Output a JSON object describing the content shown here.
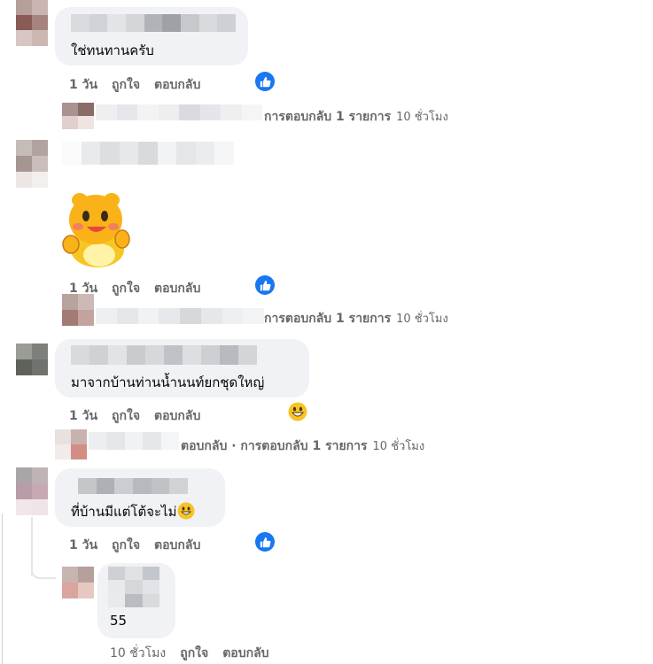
{
  "comments": [
    {
      "text": "ใช่ทนทานครับ",
      "actions": {
        "time": "1 วัน",
        "like": "ถูกใจ",
        "reply": "ตอบกลับ"
      },
      "replies_summary": {
        "text": "การตอบกลับ 1 รายการ",
        "time": "10 ชั่วโมง"
      }
    },
    {
      "text": "",
      "actions": {
        "time": "1 วัน",
        "like": "ถูกใจ",
        "reply": "ตอบกลับ"
      },
      "replies_summary": {
        "text": "การตอบกลับ 1 รายการ",
        "time": "10 ชั่วโมง"
      }
    },
    {
      "text": "มาจากบ้านท่านน้ำนนท์ยกชุดใหญ่",
      "actions": {
        "time": "1 วัน",
        "like": "ถูกใจ",
        "reply": "ตอบกลับ"
      },
      "replies_summary": {
        "prefix": "ตอบกลับ · ",
        "text": "การตอบกลับ 1 รายการ",
        "time": "10 ชั่วโมง"
      }
    },
    {
      "text": "ที่บ้านมีแต่โต้จะไม่",
      "actions": {
        "time": "1 วัน",
        "like": "ถูกใจ",
        "reply": "ตอบกลับ"
      }
    }
  ],
  "reply": {
    "text": "55",
    "actions": {
      "time": "10 ชั่วโมง",
      "like": "ถูกใจ",
      "reply": "ตอบกลับ"
    }
  },
  "icons": {
    "like": "thumbs-up-icon",
    "emoji_grin": "grinning-emoji-icon",
    "emoji_smile": "smiling-emoji-icon",
    "sticker": "sticker-character"
  },
  "colors": {
    "bubble": "#f0f2f5",
    "meta": "#65676b",
    "like": "#1877f2"
  }
}
